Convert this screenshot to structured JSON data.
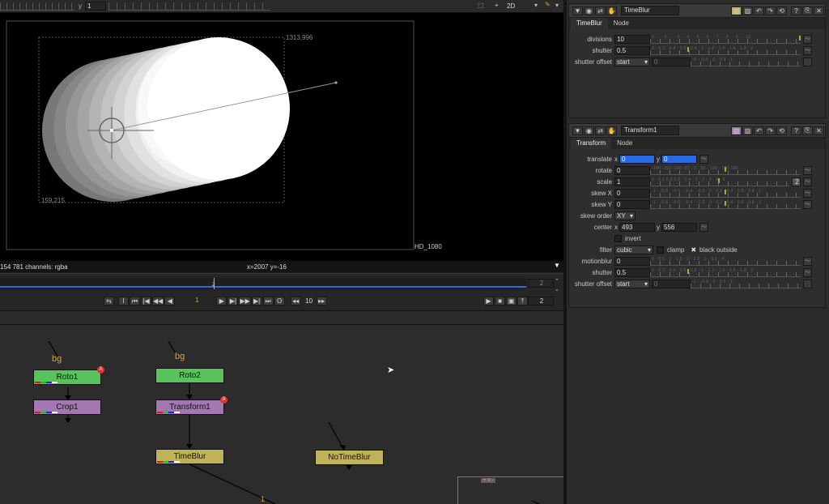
{
  "viewer": {
    "toolbar": {
      "y_label": "y",
      "y_value": "1",
      "view_mode": "2D"
    },
    "format_label": "HD_1080",
    "bbox_top_right": "1313,996",
    "bbox_bottom_left": "159,215",
    "status_left": "154 781 channels: rgba",
    "status_coords": "x=2007 y=-16"
  },
  "timeline": {
    "current_frame_marker": "2",
    "frame_field": "1",
    "increment": "10",
    "end_frame_top": "2",
    "end_frame_bottom": "2"
  },
  "dag": {
    "nodes": {
      "roto1": "Roto1",
      "crop1": "Crop1",
      "roto2": "Roto2",
      "transform1": "Transform1",
      "timeblur": "TimeBlur",
      "notimeblur": "NoTimeBlur"
    },
    "bg_label": "bg",
    "badge": "A",
    "pipe_number": "1",
    "backdrop_label": "+ ≡ -"
  },
  "timeblur_panel": {
    "name": "TimeBlur",
    "tabs": [
      "TimeBlur",
      "Node"
    ],
    "divisions_label": "divisions",
    "divisions_value": "10",
    "shutter_label": "shutter",
    "shutter_value": "0.5",
    "shutter_offset_label": "shutter offset",
    "shutter_offset_value": "start",
    "shutter_offset_custom": "0"
  },
  "transform_panel": {
    "name": "Transform1",
    "tabs": [
      "Transform",
      "Node"
    ],
    "translate_label": "translate",
    "translate_x_label": "x",
    "translate_x": "0",
    "translate_y_label": "y",
    "translate_y": "0",
    "rotate_label": "rotate",
    "rotate_value": "0",
    "scale_label": "scale",
    "scale_value": "1",
    "scale_count": "2",
    "skewx_label": "skew X",
    "skewx_value": "0",
    "skewy_label": "skew Y",
    "skewy_value": "0",
    "skew_order_label": "skew order",
    "skew_order_value": "XY",
    "center_label": "center",
    "center_x_label": "x",
    "center_x": "493",
    "center_y_label": "y",
    "center_y": "556",
    "invert_label": "invert",
    "filter_label": "filter",
    "filter_value": "cubic",
    "clamp_label": "clamp",
    "black_outside_label": "black outside",
    "motionblur_label": "motionblur",
    "motionblur_value": "0",
    "shutter_label": "shutter",
    "shutter_value": "0.5",
    "shutter_offset_label": "shutter offset",
    "shutter_offset_value": "start",
    "shutter_offset_custom": "0"
  },
  "slider_scales": {
    "divisions": "1 · · · 2 · · · 3 · · 4 · · 5 · · 6 · · 7 · · 8 · · 9 · · 10",
    "shutter": "0 · 0.2 · 0.4 · 0.6 · 0.8 · 1 · 1.2 · 1.4 · 1.6 · 1.8 · 2",
    "rotate": "-180 -150 -100 -50 · 0 · 50 · 100 · 150 180",
    "scale": "0 · 0.1 0.2 0.3 · 0.4 · 1 · 2 · 3 · 4 · 5",
    "skew": "-1 · -0.8 · -0.6 · -0.4 · -0.2 · 0 · 0.2 · 0.4 · 0.6 · 0.8 · 1",
    "motionblur": "0 · 0.5 · 1 · 1.5 · 2 · 2.5 · 3 · 3.5 · 4",
    "offset": "-1 · -0.5 · 0 · 0.5 · 1"
  },
  "colors": {
    "accent": "#b9a632",
    "roto": "#58c35c",
    "transform": "#a377b1",
    "timeblur": "#c0b258",
    "selection_blue": "#2a6ae0"
  }
}
